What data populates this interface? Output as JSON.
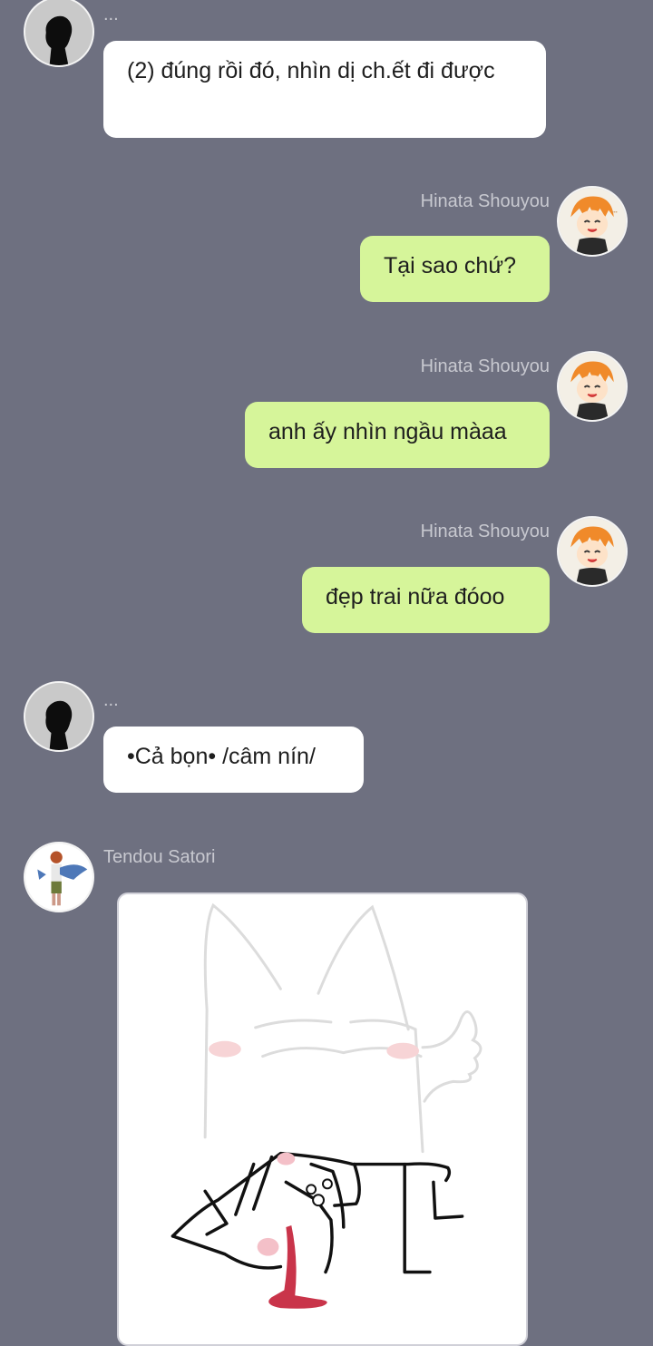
{
  "messages": [
    {
      "sender": "...",
      "text": "(2) đúng rồi đó, nhìn dị ch.ết đi được"
    },
    {
      "sender": "Hinata Shouyou",
      "text": "Tại sao chứ?"
    },
    {
      "sender": "Hinata Shouyou",
      "text": "anh ấy nhìn ngầu màaa"
    },
    {
      "sender": "Hinata Shouyou",
      "text": "đẹp trai nữa đóoo"
    },
    {
      "sender": "...",
      "text": "•Cả bọn• /câm nín/"
    },
    {
      "sender": "Tendou Satori"
    }
  ],
  "colors": {
    "background": "#6e7080",
    "outgoing_bubble": "#d6f59a",
    "incoming_bubble": "#ffffff",
    "sender_name": "#c8c9d0"
  },
  "icons": {
    "silhouette": "silhouette-avatar-icon",
    "hinata": "hinata-avatar-icon",
    "tendou": "tendou-avatar-icon",
    "sticker": "cat-sticker-image"
  }
}
